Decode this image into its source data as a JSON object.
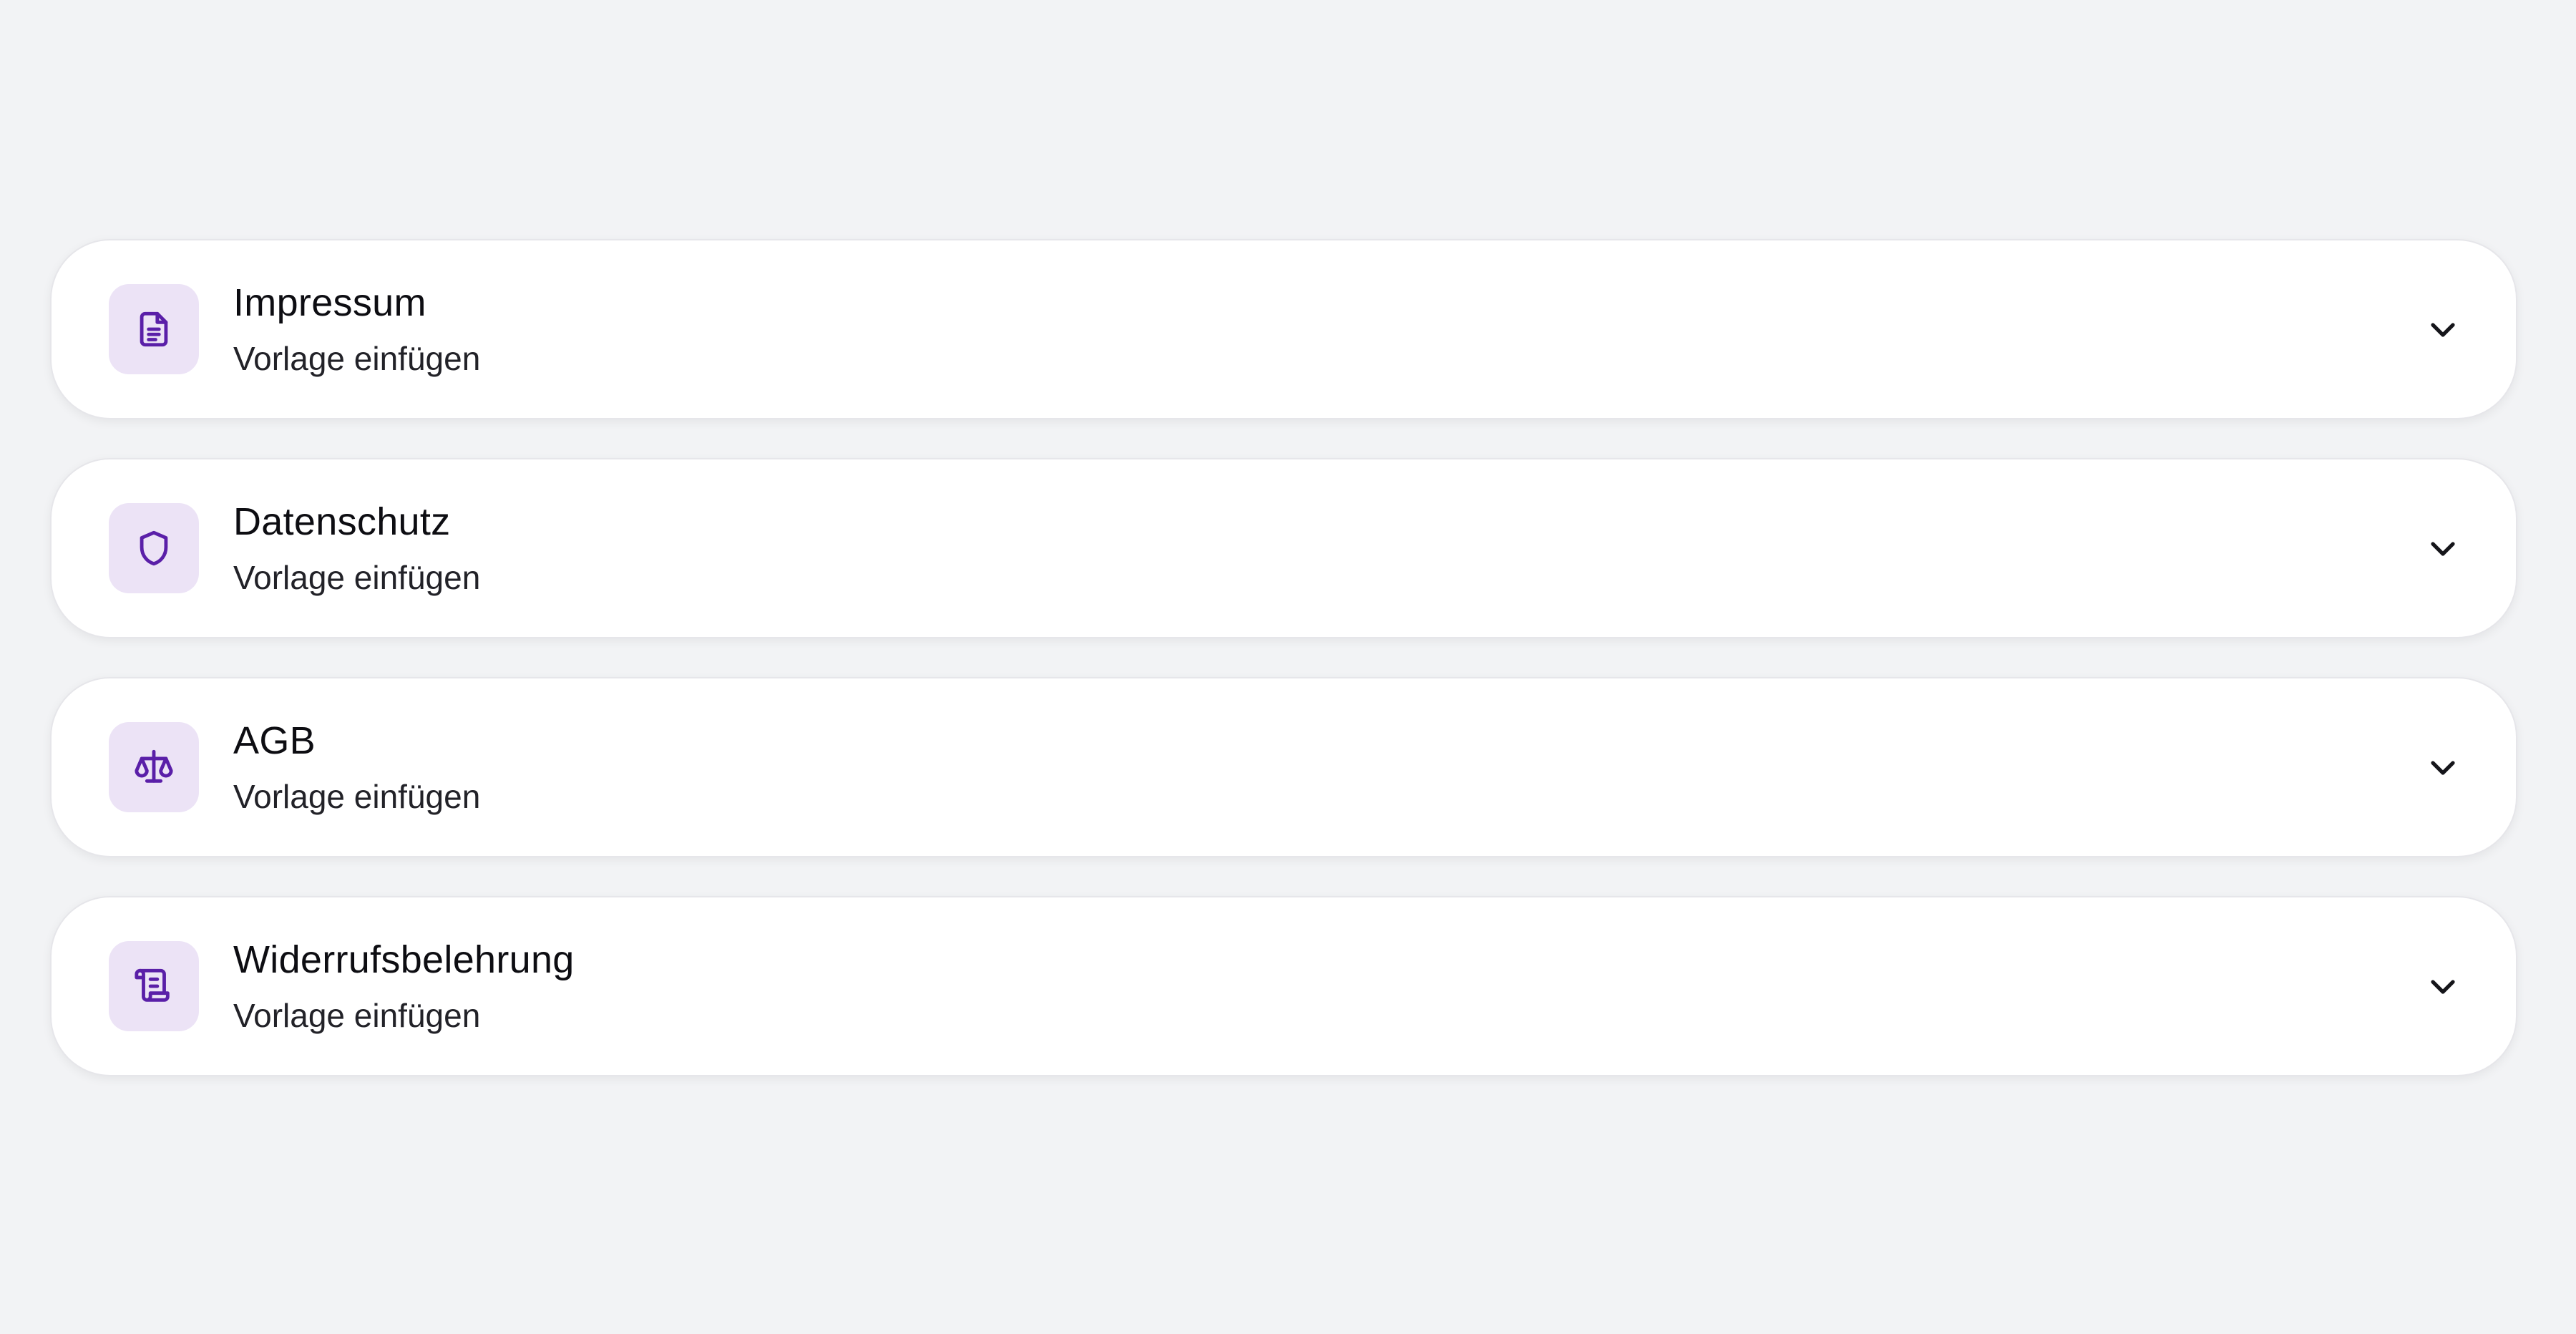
{
  "accent_color": "#5a1fa8",
  "icon_bg_color": "#ece3f6",
  "items": [
    {
      "title": "Impressum",
      "subtitle": "Vorlage einfügen",
      "icon": "document-icon"
    },
    {
      "title": "Datenschutz",
      "subtitle": "Vorlage einfügen",
      "icon": "shield-icon"
    },
    {
      "title": "AGB",
      "subtitle": "Vorlage einfügen",
      "icon": "scale-icon"
    },
    {
      "title": "Widerrufsbelehrung",
      "subtitle": "Vorlage einfügen",
      "icon": "scroll-icon"
    }
  ]
}
